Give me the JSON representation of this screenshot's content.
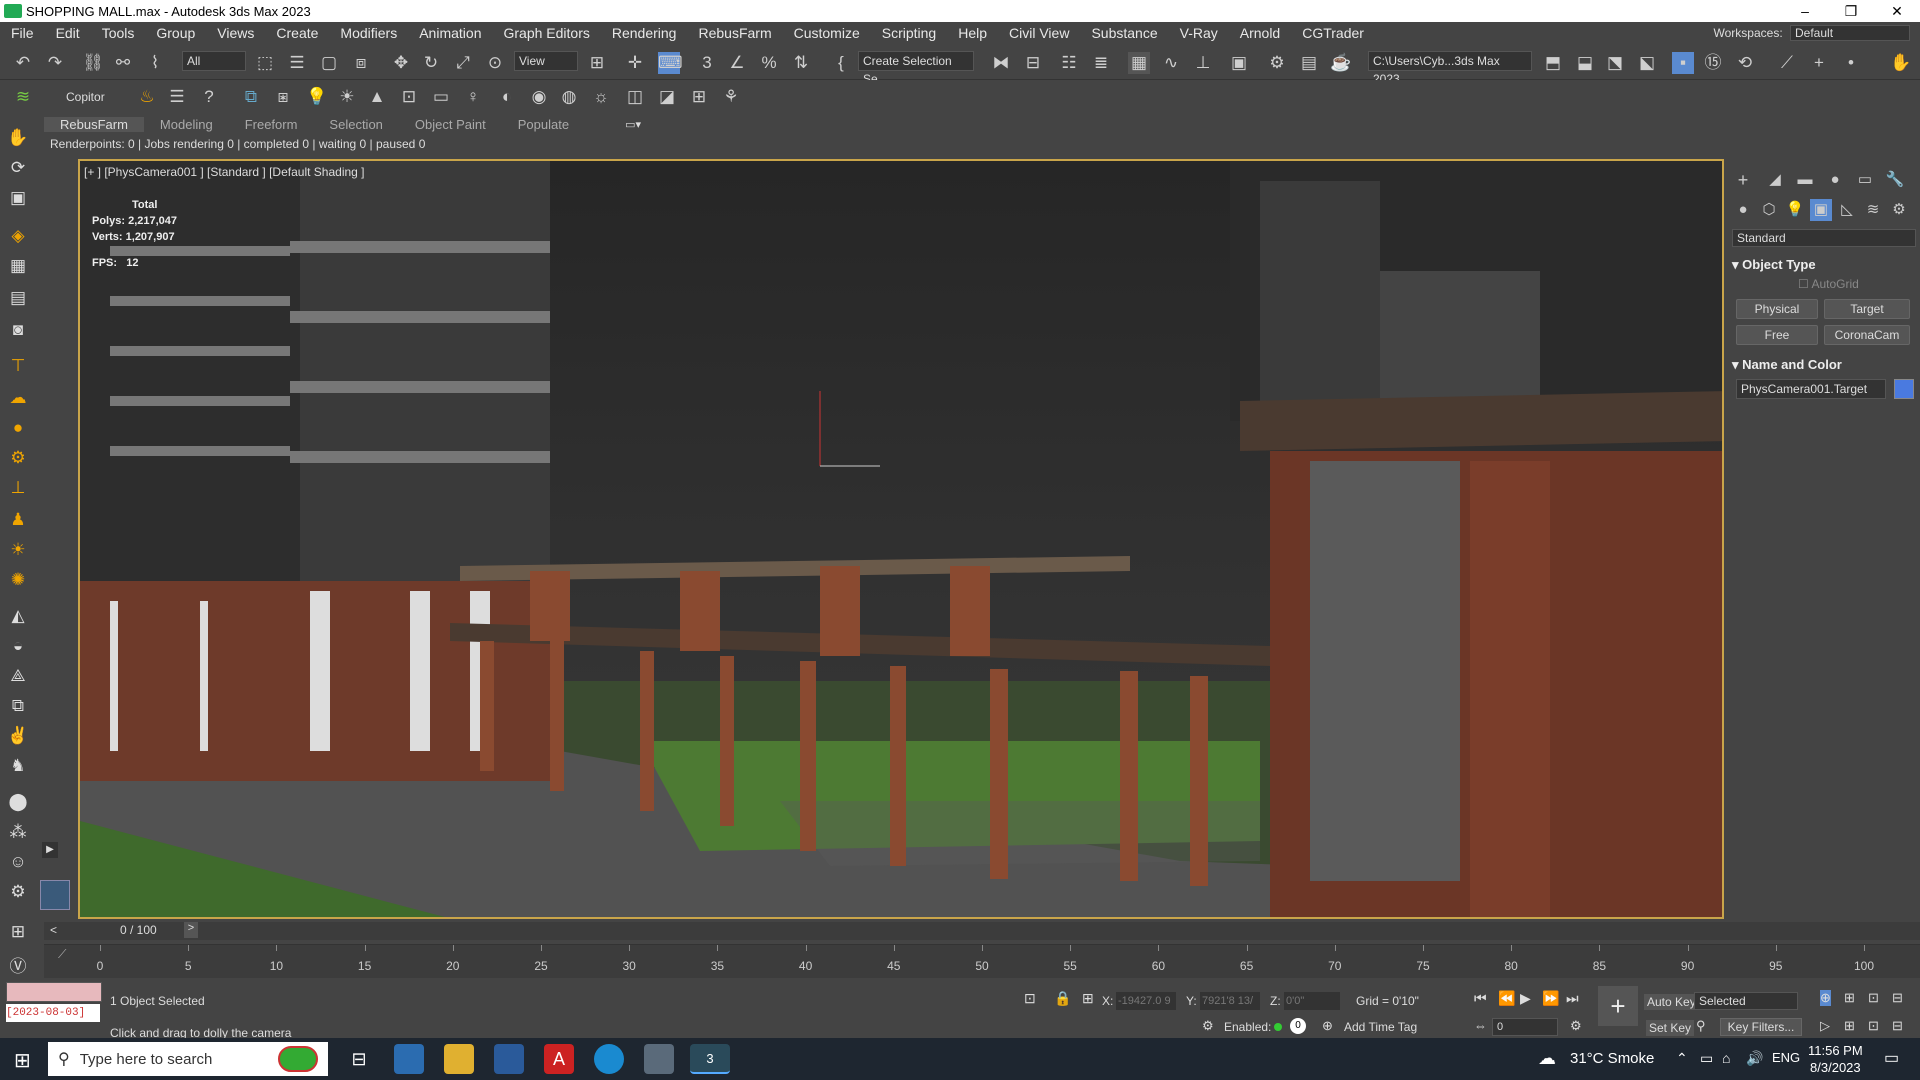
{
  "window": {
    "title": "SHOPPING MALL.max - Autodesk 3ds Max 2023"
  },
  "menu": [
    "File",
    "Edit",
    "Tools",
    "Group",
    "Views",
    "Create",
    "Modifiers",
    "Animation",
    "Graph Editors",
    "Rendering",
    "RebusFarm",
    "Customize",
    "Scripting",
    "Help",
    "Civil View",
    "Substance",
    "V-Ray",
    "Arnold",
    "CGTrader"
  ],
  "workspace": {
    "label": "Workspaces:",
    "value": "Default"
  },
  "toolbar": {
    "filter": "All",
    "refcoord": "View",
    "selection_set": "Create Selection Se",
    "path": "C:\\Users\\Cyb...3ds Max 2023",
    "copitor": "Copitor"
  },
  "tabs": [
    "RebusFarm",
    "Modeling",
    "Freeform",
    "Selection",
    "Object Paint",
    "Populate"
  ],
  "render_status": "Renderpoints: 0 | Jobs rendering 0 | completed 0 | waiting 0 | paused 0",
  "viewport": {
    "label": "[+ ] [PhysCamera001 ] [Standard ] [Default Shading ]",
    "stats_header": "Total",
    "polys_label": "Polys:",
    "polys": "2,217,047",
    "verts_label": "Verts:",
    "verts": "1,207,907",
    "fps_label": "FPS:",
    "fps": "12"
  },
  "command_panel": {
    "category": "Standard",
    "rollout_object_type": "Object Type",
    "autogrid": "AutoGrid",
    "buttons": [
      "Physical",
      "Target",
      "Free",
      "CoronaCam"
    ],
    "rollout_name_color": "Name and Color",
    "object_name": "PhysCamera001.Target",
    "color": "#4a7ae0"
  },
  "timeline": {
    "frame": "0 / 100",
    "ticks": [
      "0",
      "5",
      "10",
      "15",
      "20",
      "25",
      "30",
      "35",
      "40",
      "45",
      "50",
      "55",
      "60",
      "65",
      "70",
      "75",
      "80",
      "85",
      "90",
      "95",
      "100"
    ]
  },
  "status": {
    "selected": "1 Object Selected",
    "prompt": "Click and drag to dolly the camera",
    "date": "[2023-08-03]",
    "x_label": "X:",
    "x": "-19427.0 9",
    "y_label": "Y:",
    "y": "7921'8 13/",
    "z_label": "Z:",
    "z": "0'0\"",
    "grid": "Grid = 0'10\"",
    "enabled": "Enabled:",
    "add_time_tag": "Add Time Tag",
    "auto_key": "Auto Key",
    "set_key": "Set Key",
    "key_mode": "Selected",
    "key_filters": "Key Filters...",
    "frame_field": "0"
  },
  "taskbar": {
    "search_placeholder": "Type here to search",
    "weather": "31°C  Smoke",
    "lang": "ENG",
    "time": "11:56 PM",
    "date": "8/3/2023"
  }
}
